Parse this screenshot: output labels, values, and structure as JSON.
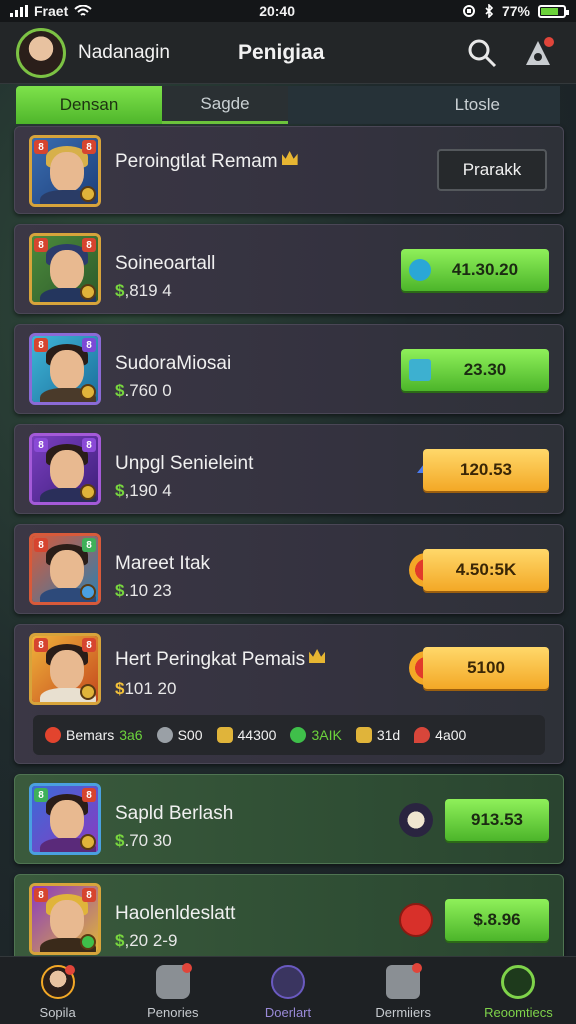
{
  "status_bar": {
    "carrier": "Fraet",
    "time": "20:40",
    "battery": "77%",
    "battery_level": 0.77
  },
  "header": {
    "user_name": "Nadanagin",
    "title": "Penigiaa"
  },
  "tabs": [
    {
      "label": "Densan"
    },
    {
      "label": "Sagde"
    },
    {
      "label": "Ltosle"
    }
  ],
  "cards": [
    {
      "name": "Peroingtlat Remam",
      "button": "Prarakk"
    },
    {
      "name": "Soineoartall",
      "currency": "$",
      "amount": ",819 4",
      "button": "41.30.20"
    },
    {
      "name": "SudoraMiosai",
      "currency": "$",
      "amount": ".760 0",
      "button": "23.30"
    },
    {
      "name": "Unpgl Senieleint",
      "currency": "$",
      "amount": ",190 4",
      "button": "120.53"
    },
    {
      "name": "Mareet Itak",
      "currency": "$",
      "amount": ".10 23",
      "button": "4.50:5K"
    },
    {
      "name": "Hert Peringkat Pemais",
      "currency": "$",
      "amount": "101 20",
      "button": "5100",
      "stats": [
        {
          "label": "Bemars",
          "value": "3a6"
        },
        {
          "value": "S00"
        },
        {
          "value": "44300"
        },
        {
          "value": "3AIK"
        },
        {
          "value": "31d"
        },
        {
          "value": "4a00"
        }
      ]
    },
    {
      "name": "Sapld Berlash",
      "currency": "$",
      "amount": ".70 30",
      "button": "913.53"
    },
    {
      "name": "Haolenldeslatt",
      "currency": "$",
      "amount": ",20 2-9",
      "button": "$.8.96"
    }
  ],
  "nav": [
    {
      "label": "Sopila"
    },
    {
      "label": "Penories"
    },
    {
      "label": "Doerlart"
    },
    {
      "label": "Dermiiers"
    },
    {
      "label": "Reoomtiecs"
    }
  ],
  "colors": {
    "accent": "#6cc43c",
    "gold": "#f3a826",
    "dark": "#232628"
  },
  "icons": {
    "search": "search-icon",
    "alert": "alert-icon"
  }
}
